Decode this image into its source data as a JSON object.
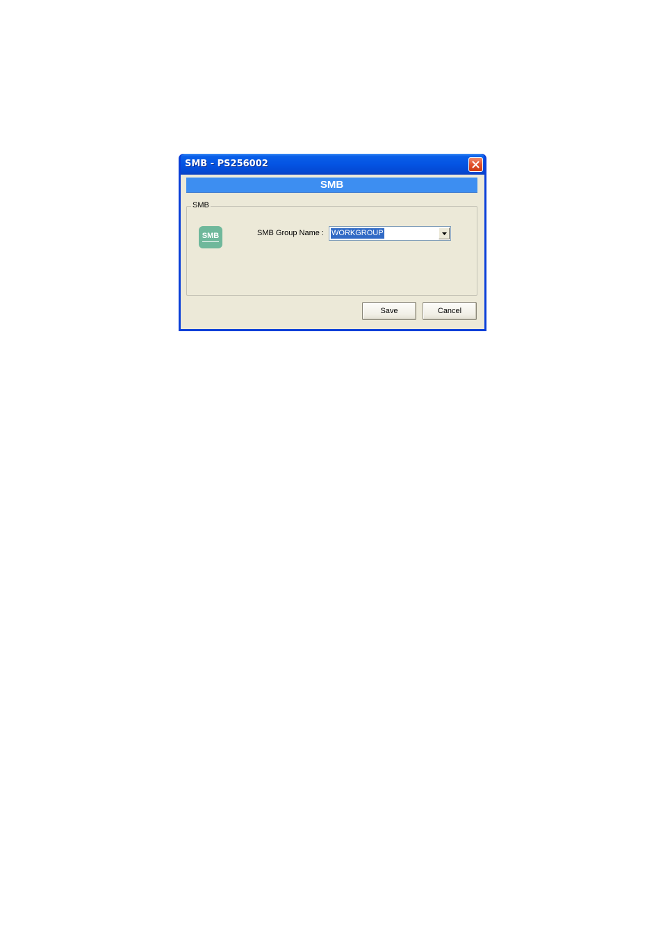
{
  "window": {
    "title": "SMB - PS256002"
  },
  "banner": {
    "title": "SMB"
  },
  "group": {
    "legend": "SMB",
    "logo_text": "SMB",
    "field_label": "SMB Group Name :",
    "field_value": "WORKGROUP"
  },
  "buttons": {
    "save_label": "Save",
    "cancel_label": "Cancel"
  },
  "icons": {
    "close": "close-icon",
    "dropdown": "chevron-down-icon",
    "logo": "smb-logo-icon"
  },
  "colors": {
    "title_bar": "#0454e3",
    "banner": "#3d8ef1",
    "client_bg": "#ece9d8",
    "close_button": "#e2512d",
    "selection": "#316ac5",
    "logo_bg": "#6fb89b"
  }
}
